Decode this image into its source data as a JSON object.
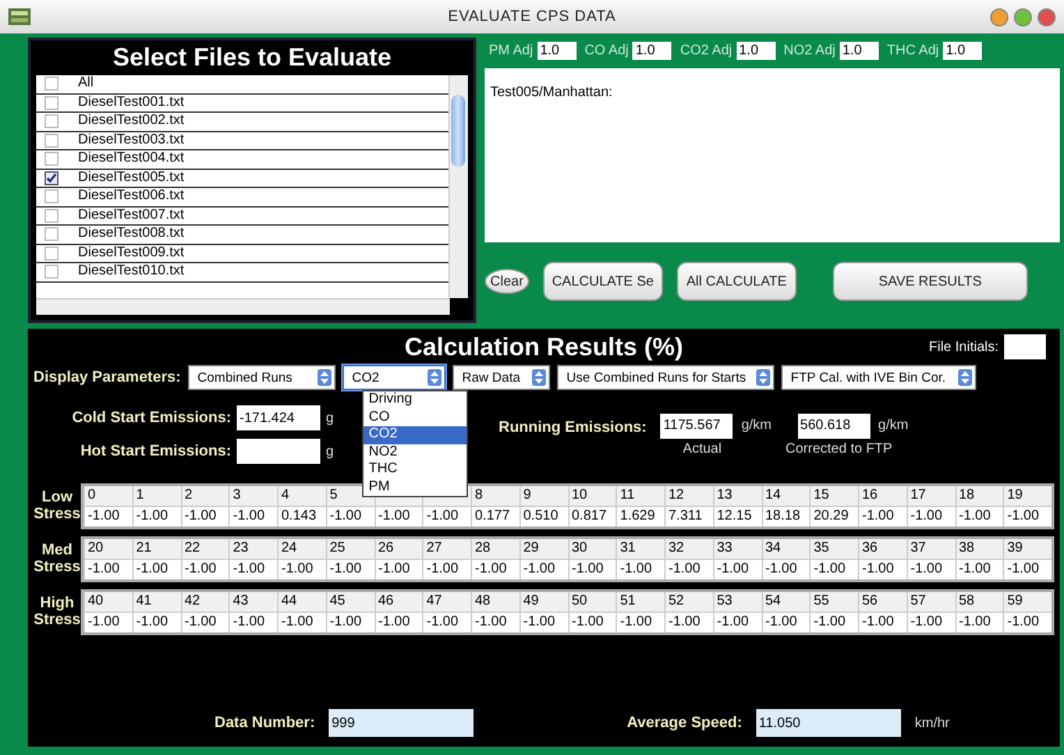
{
  "window": {
    "title": "EVALUATE CPS DATA"
  },
  "files": {
    "title": "Select Files to Evaluate",
    "items": [
      {
        "name": "All",
        "checked": false
      },
      {
        "name": "DieselTest001.txt",
        "checked": false
      },
      {
        "name": "DieselTest002.txt",
        "checked": false
      },
      {
        "name": "DieselTest003.txt",
        "checked": false
      },
      {
        "name": "DieselTest004.txt",
        "checked": false
      },
      {
        "name": "DieselTest005.txt",
        "checked": true
      },
      {
        "name": "DieselTest006.txt",
        "checked": false
      },
      {
        "name": "DieselTest007.txt",
        "checked": false
      },
      {
        "name": "DieselTest008.txt",
        "checked": false
      },
      {
        "name": "DieselTest009.txt",
        "checked": false
      },
      {
        "name": "DieselTest010.txt",
        "checked": false
      }
    ]
  },
  "adjustments": [
    {
      "label": "PM Adj",
      "value": "1.0"
    },
    {
      "label": "CO Adj",
      "value": "1.0"
    },
    {
      "label": "CO2 Adj",
      "value": "1.0"
    },
    {
      "label": "NO2 Adj",
      "value": "1.0"
    },
    {
      "label": "THC Adj",
      "value": "1.0"
    }
  ],
  "notes": {
    "value": "Test005/Manhattan:"
  },
  "buttons": [
    {
      "kind": "round",
      "label": "Clear"
    },
    {
      "kind": "wide",
      "label": "CALCULATE Se"
    },
    {
      "kind": "wide",
      "label": "All CALCULATE"
    },
    {
      "kind": "large",
      "label": "SAVE RESULTS"
    }
  ],
  "results": {
    "title": "Calculation Results (%)",
    "file_initials_label": "File Initials:"
  },
  "display_parameters": {
    "label": "Display Parameters:",
    "selects": [
      {
        "value": "Combined Runs",
        "expanded": false
      },
      {
        "value": "CO2",
        "expanded": true,
        "options": [
          {
            "label": "Driving",
            "selected": false
          },
          {
            "label": "CO",
            "selected": false
          },
          {
            "label": "CO2",
            "selected": true
          },
          {
            "label": "NO2",
            "selected": false
          },
          {
            "label": "THC",
            "selected": false
          },
          {
            "label": "PM",
            "selected": false
          }
        ]
      },
      {
        "value": "Raw Data",
        "expanded": false
      },
      {
        "value": "Use Combined Runs for Starts",
        "expanded": false
      },
      {
        "value": "FTP Cal. with IVE Bin Cor.",
        "expanded": false
      }
    ]
  },
  "emissions": {
    "cold_start": {
      "label": "Cold Start Emissions:",
      "value": "-171.424",
      "unit": "g"
    },
    "hot_start": {
      "label": "Hot Start Emissions:",
      "unit": "g"
    },
    "running": {
      "label": "Running Emissions:",
      "actual": {
        "value": "1175.567",
        "unit": "g/km",
        "caption": "Actual"
      },
      "corrected": {
        "value": "560.618",
        "unit": "g/km",
        "caption": "Corrected to FTP"
      }
    }
  },
  "stress_tables": [
    {
      "label": "Low Stress",
      "bins": [
        "0",
        "1",
        "2",
        "3",
        "4",
        "5"
      ],
      "bins_after_cover": [
        "8",
        "9",
        "10",
        "11",
        "12",
        "13",
        "14",
        "15",
        "16",
        "17",
        "18",
        "19"
      ],
      "values": [
        "-1.00",
        "-1.00",
        "-1.00",
        "-1.00",
        "0.143",
        "-1.00",
        "-1.00",
        "-1.00",
        "0.177",
        "0.510",
        "0.817",
        "1.629",
        "7.311",
        "12.15",
        "18.18",
        "20.29",
        "-1.00",
        "-1.00",
        "-1.00",
        "-1.00"
      ]
    },
    {
      "label": "Med Stress",
      "bins": [
        "20",
        "21",
        "22",
        "23",
        "24",
        "25",
        "26",
        "27",
        "28",
        "29",
        "30",
        "31",
        "32",
        "33",
        "34",
        "35",
        "36",
        "37",
        "38",
        "39"
      ],
      "values": [
        "-1.00",
        "-1.00",
        "-1.00",
        "-1.00",
        "-1.00",
        "-1.00",
        "-1.00",
        "-1.00",
        "-1.00",
        "-1.00",
        "-1.00",
        "-1.00",
        "-1.00",
        "-1.00",
        "-1.00",
        "-1.00",
        "-1.00",
        "-1.00",
        "-1.00",
        "-1.00"
      ]
    },
    {
      "label": "High Stress",
      "bins": [
        "40",
        "41",
        "42",
        "43",
        "44",
        "45",
        "46",
        "47",
        "48",
        "49",
        "50",
        "51",
        "52",
        "53",
        "54",
        "55",
        "56",
        "57",
        "58",
        "59"
      ],
      "values": [
        "-1.00",
        "-1.00",
        "-1.00",
        "-1.00",
        "-1.00",
        "-1.00",
        "-1.00",
        "-1.00",
        "-1.00",
        "-1.00",
        "-1.00",
        "-1.00",
        "-1.00",
        "-1.00",
        "-1.00",
        "-1.00",
        "-1.00",
        "-1.00",
        "-1.00",
        "-1.00"
      ]
    }
  ],
  "footer": {
    "data_number": {
      "label": "Data Number:",
      "value": "999"
    },
    "average_speed": {
      "label": "Average Speed:",
      "value": "11.050",
      "unit": "km/hr"
    }
  }
}
